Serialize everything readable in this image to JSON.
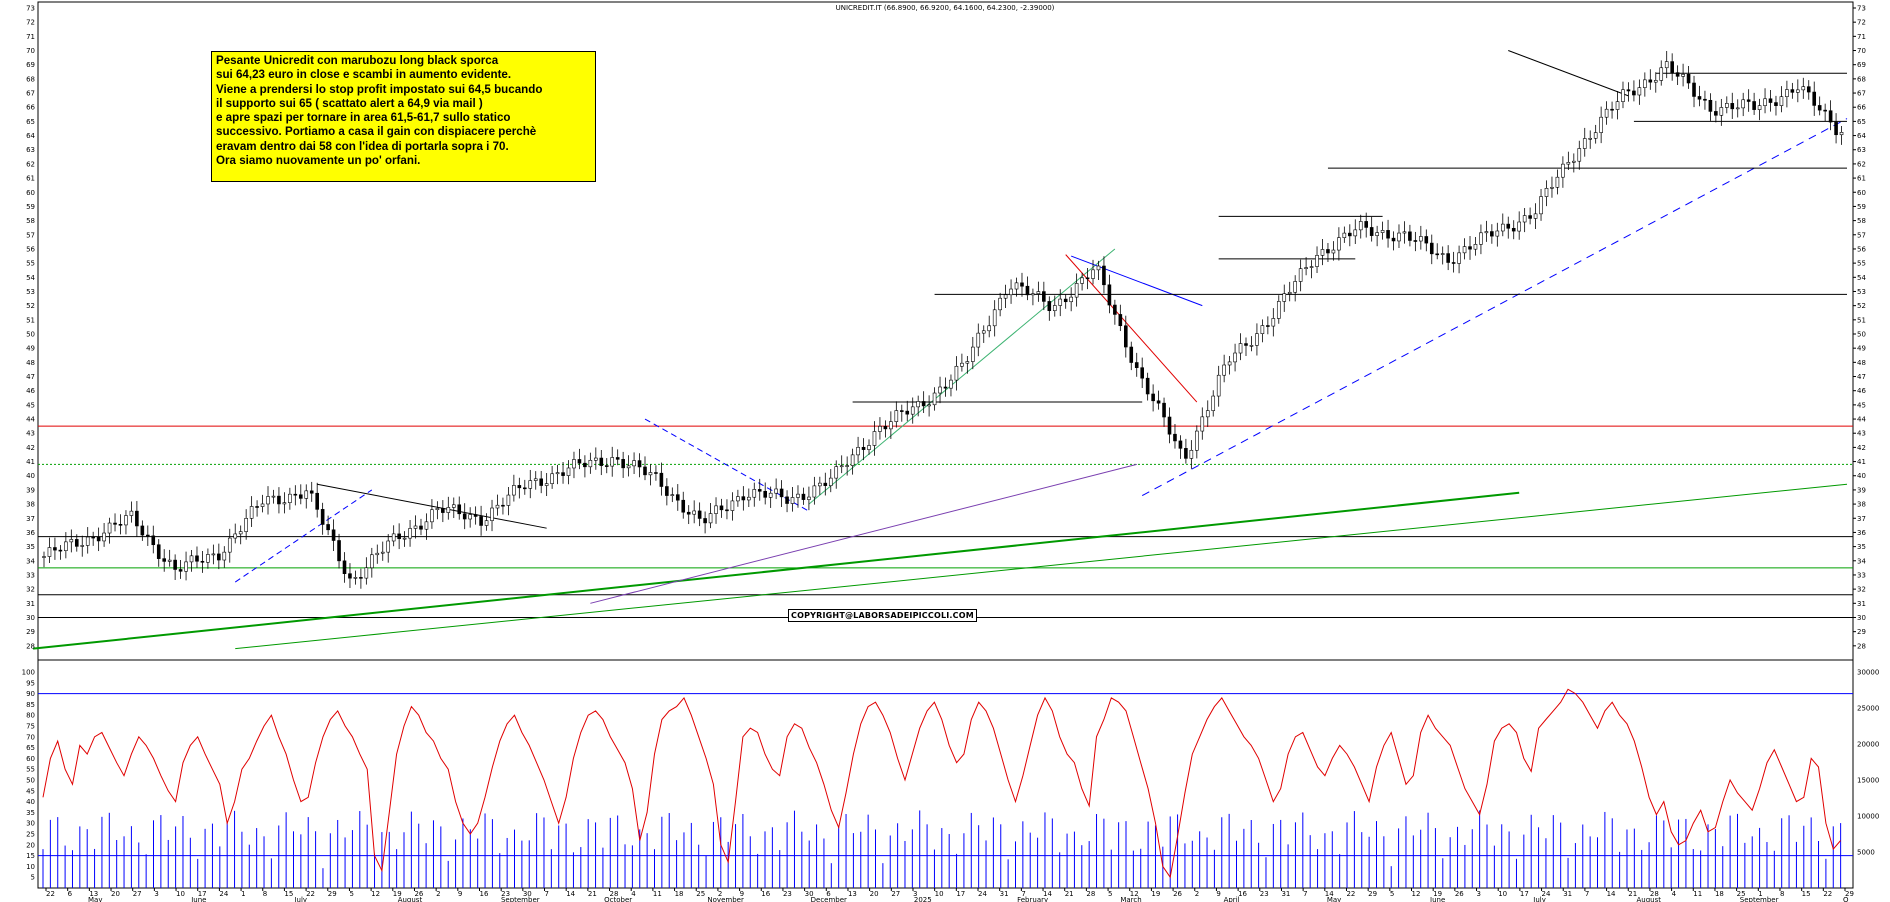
{
  "chart_data": [
    {
      "type": "candlestick",
      "title": "UNICREDIT.IT (66.8900, 66.9200, 64.1600, 64.2300, -2.39000)",
      "ylim": [
        27,
        73
      ],
      "y_ticks": [
        28,
        29,
        30,
        31,
        32,
        33,
        34,
        35,
        36,
        37,
        38,
        39,
        40,
        41,
        42,
        43,
        44,
        45,
        46,
        47,
        48,
        49,
        50,
        51,
        52,
        53,
        54,
        55,
        56,
        57,
        58,
        59,
        60,
        61,
        62,
        63,
        64,
        65,
        66,
        67,
        68,
        69,
        70,
        71,
        72,
        73
      ],
      "grid": false,
      "x_day_labels": [
        "22",
        "6",
        "13",
        "20",
        "27",
        "3",
        "10",
        "17",
        "24",
        "1",
        "8",
        "15",
        "22",
        "29",
        "5",
        "12",
        "19",
        "26",
        "2",
        "9",
        "16",
        "23",
        "30",
        "7",
        "14",
        "21",
        "28",
        "4",
        "11",
        "18",
        "25",
        "2",
        "9",
        "16",
        "23",
        "30",
        "6",
        "13",
        "20",
        "27",
        "3",
        "10",
        "17",
        "24",
        "31",
        "7",
        "14",
        "21",
        "28",
        "5",
        "12",
        "19",
        "26",
        "2",
        "9",
        "16",
        "23",
        "31",
        "7",
        "14",
        "22",
        "29",
        "5",
        "12",
        "19",
        "26",
        "3",
        "10",
        "17",
        "24",
        "31",
        "7",
        "14",
        "21",
        "28",
        "4",
        "11",
        "18",
        "25",
        "1",
        "8",
        "15",
        "22",
        "29"
      ],
      "x_month_labels": [
        "May",
        "June",
        "July",
        "August",
        "September",
        "October",
        "November",
        "December",
        "2025",
        "February",
        "March",
        "April",
        "May",
        "June",
        "July",
        "August",
        "September",
        "O"
      ],
      "close_anchors": [
        {
          "label": "start",
          "close": 34.3
        },
        {
          "label": "May",
          "close": 35.6
        },
        {
          "label": "mid-June",
          "close": 37.0
        },
        {
          "label": "late-June",
          "close": 33.3
        },
        {
          "label": "early-July",
          "close": 34.6
        },
        {
          "label": "mid-July",
          "close": 38.2
        },
        {
          "label": "late-July",
          "close": 38.9
        },
        {
          "label": "early-August",
          "close": 32.6
        },
        {
          "label": "mid-August",
          "close": 35.5
        },
        {
          "label": "September",
          "close": 37.6
        },
        {
          "label": "late-September",
          "close": 37.0
        },
        {
          "label": "early-October",
          "close": 39.4
        },
        {
          "label": "mid-October",
          "close": 40.5
        },
        {
          "label": "early-November",
          "close": 41.3
        },
        {
          "label": "November",
          "close": 39.7
        },
        {
          "label": "late-November",
          "close": 36.6
        },
        {
          "label": "early-December",
          "close": 38.9
        },
        {
          "label": "mid-December",
          "close": 38.3
        },
        {
          "label": "early-January",
          "close": 39.8
        },
        {
          "label": "mid-January",
          "close": 43.3
        },
        {
          "label": "late-January",
          "close": 45.0
        },
        {
          "label": "February",
          "close": 47.8
        },
        {
          "label": "early-March",
          "close": 53.6
        },
        {
          "label": "mid-March",
          "close": 51.9
        },
        {
          "label": "late-March",
          "close": 54.6
        },
        {
          "label": "early-April",
          "close": 47.0
        },
        {
          "label": "April-low",
          "close": 41.2
        },
        {
          "label": "mid-April",
          "close": 48.0
        },
        {
          "label": "late-April",
          "close": 51.2
        },
        {
          "label": "early-May",
          "close": 55.6
        },
        {
          "label": "mid-May",
          "close": 57.4
        },
        {
          "label": "June",
          "close": 57.0
        },
        {
          "label": "late-June",
          "close": 55.3
        },
        {
          "label": "early-July",
          "close": 57.0
        },
        {
          "label": "mid-July",
          "close": 58.6
        },
        {
          "label": "late-July",
          "close": 63.2
        },
        {
          "label": "early-August",
          "close": 66.7
        },
        {
          "label": "mid-August",
          "close": 68.9
        },
        {
          "label": "late-August",
          "close": 66.0
        },
        {
          "label": "early-September",
          "close": 66.0
        },
        {
          "label": "mid-September",
          "close": 67.4
        },
        {
          "label": "last",
          "close": 64.23
        }
      ],
      "horizontal_levels": [
        {
          "value": 30.0,
          "color": "#000000"
        },
        {
          "value": 31.6,
          "color": "#000000"
        },
        {
          "value": 33.5,
          "color": "#00a000"
        },
        {
          "value": 35.7,
          "color": "#000000"
        },
        {
          "value": 40.8,
          "color": "#00a000",
          "style": "dotted"
        },
        {
          "value": 43.5,
          "color": "#e00000"
        }
      ],
      "annotations": [
        "COPYRIGHT@LABORSADEIPICCOLI.COM"
      ]
    },
    {
      "type": "line-bar",
      "ylim": [
        0,
        100
      ],
      "y_ticks": [
        5,
        10,
        15,
        20,
        25,
        30,
        35,
        40,
        45,
        50,
        55,
        60,
        65,
        70,
        75,
        80,
        85,
        90,
        95,
        100
      ],
      "right_ticks": [
        5000,
        10000,
        15000,
        20000,
        25000,
        30000
      ],
      "levels": [
        15,
        90
      ],
      "series": [
        {
          "kind": "oscillator",
          "color": "#e00000",
          "values": [
            42,
            60,
            68,
            55,
            48,
            66,
            62,
            70,
            72,
            65,
            58,
            52,
            62,
            70,
            66,
            60,
            52,
            45,
            40,
            58,
            66,
            70,
            62,
            55,
            48,
            30,
            40,
            55,
            60,
            68,
            75,
            80,
            70,
            62,
            50,
            40,
            42,
            58,
            70,
            78,
            82,
            75,
            70,
            62,
            55,
            15,
            8,
            35,
            62,
            75,
            84,
            80,
            72,
            68,
            60,
            55,
            40,
            30,
            25,
            30,
            42,
            56,
            68,
            76,
            80,
            72,
            66,
            58,
            50,
            40,
            30,
            42,
            60,
            72,
            80,
            82,
            78,
            70,
            64,
            58,
            46,
            22,
            35,
            62,
            78,
            82,
            84,
            88,
            80,
            70,
            60,
            48,
            20,
            12,
            40,
            70,
            74,
            72,
            62,
            55,
            52,
            70,
            76,
            74,
            65,
            58,
            48,
            36,
            28,
            44,
            62,
            76,
            84,
            86,
            80,
            72,
            60,
            50,
            62,
            74,
            82,
            86,
            78,
            66,
            58,
            62,
            78,
            86,
            82,
            74,
            62,
            50,
            40,
            52,
            66,
            80,
            88,
            82,
            70,
            62,
            58,
            46,
            38,
            70,
            78,
            88,
            86,
            82,
            70,
            58,
            46,
            30,
            10,
            5,
            24,
            44,
            62,
            70,
            78,
            84,
            88,
            82,
            76,
            70,
            66,
            60,
            50,
            40,
            46,
            62,
            70,
            72,
            64,
            56,
            52,
            60,
            66,
            62,
            56,
            48,
            40,
            56,
            66,
            72,
            60,
            48,
            52,
            72,
            80,
            74,
            70,
            66,
            56,
            46,
            40,
            34,
            48,
            68,
            74,
            76,
            72,
            60,
            54,
            74,
            78,
            82,
            86,
            92,
            90,
            86,
            80,
            74,
            82,
            86,
            80,
            76,
            68,
            56,
            42,
            34,
            40,
            26,
            20,
            22,
            30,
            36,
            26,
            28,
            40,
            50,
            44,
            40,
            36,
            46,
            58,
            64,
            56,
            48,
            40,
            42,
            60,
            56,
            30,
            18,
            22
          ]
        },
        {
          "kind": "volume",
          "color": "#0000ff",
          "right_scale_max": 30000
        }
      ]
    }
  ],
  "note": {
    "lines": [
      "Pesante Unicredit con marubozu long black sporca",
      "sui 64,23 euro in close e scambi in aumento evidente.",
      "Viene a prendersi lo stop profit impostato sui 64,5 bucando",
      "il supporto sui 65 ( scattato alert a 64,9 via mail )",
      "e apre spazi per tornare in area 61,5-61,7 sullo statico",
      "successivo. Portiamo a casa il gain con dispiacere perchè",
      "eravam dentro dai 58 con l'idea di portarla sopra i 70.",
      "Ora siamo nuovamente un po' orfani."
    ]
  },
  "copyright": "COPYRIGHT@LABORSADEIPICCOLI.COM",
  "colors": {
    "up": "#000000",
    "down": "#000000",
    "trend_green": "#009900",
    "trend_blue": "#0000ff",
    "resistance_red": "#e00000",
    "note_bg": "#ffff00"
  }
}
